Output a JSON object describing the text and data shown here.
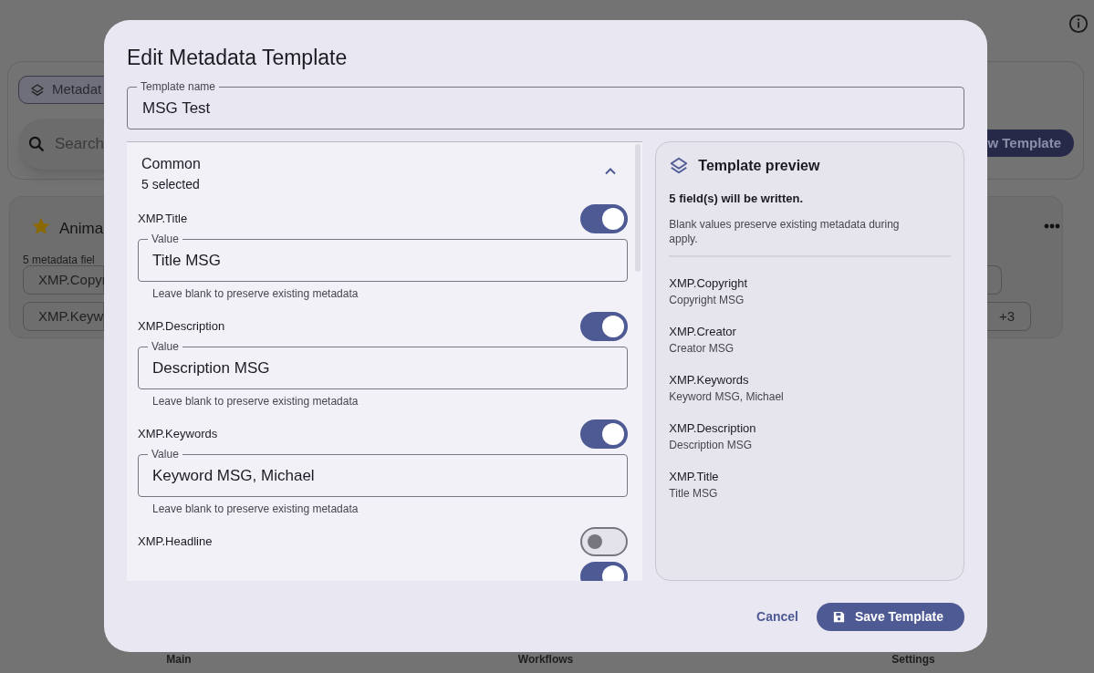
{
  "background": {
    "chip": "Metadat",
    "search_placeholder": "Search",
    "new_button": "w Template",
    "card": {
      "title": "Anima",
      "count": "5 metadata fiel",
      "chips": [
        "XMP.Copyr",
        "XMP.Keyw"
      ],
      "more": "+3"
    },
    "nav": [
      "Main",
      "Workflows",
      "Settings"
    ]
  },
  "dialog": {
    "title": "Edit Metadata Template",
    "name_field": {
      "label": "Template name",
      "value": "MSG Test"
    },
    "section": {
      "title": "Common",
      "subtitle": "5 selected",
      "expanded": true,
      "fields": [
        {
          "label": "XMP.Title",
          "on": true,
          "value_label": "Value",
          "value": "Title MSG",
          "helper": "Leave blank to preserve existing metadata"
        },
        {
          "label": "XMP.Description",
          "on": true,
          "value_label": "Value",
          "value": "Description MSG",
          "helper": "Leave blank to preserve existing metadata"
        },
        {
          "label": "XMP.Keywords",
          "on": true,
          "value_label": "Value",
          "value": "Keyword MSG, Michael",
          "helper": "Leave blank to preserve existing metadata"
        },
        {
          "label": "XMP.Headline",
          "on": false
        },
        {
          "on": true
        }
      ]
    },
    "preview": {
      "title": "Template preview",
      "summary": "5 field(s) will be written.",
      "note": "Blank values preserve existing metadata during apply.",
      "items": [
        {
          "name": "XMP.Copyright",
          "value": "Copyright MSG"
        },
        {
          "name": "XMP.Creator",
          "value": "Creator MSG"
        },
        {
          "name": "XMP.Keywords",
          "value": "Keyword MSG, Michael"
        },
        {
          "name": "XMP.Description",
          "value": "Description MSG"
        },
        {
          "name": "XMP.Title",
          "value": "Title MSG"
        }
      ]
    },
    "buttons": {
      "cancel": "Cancel",
      "save": "Save Template"
    }
  }
}
